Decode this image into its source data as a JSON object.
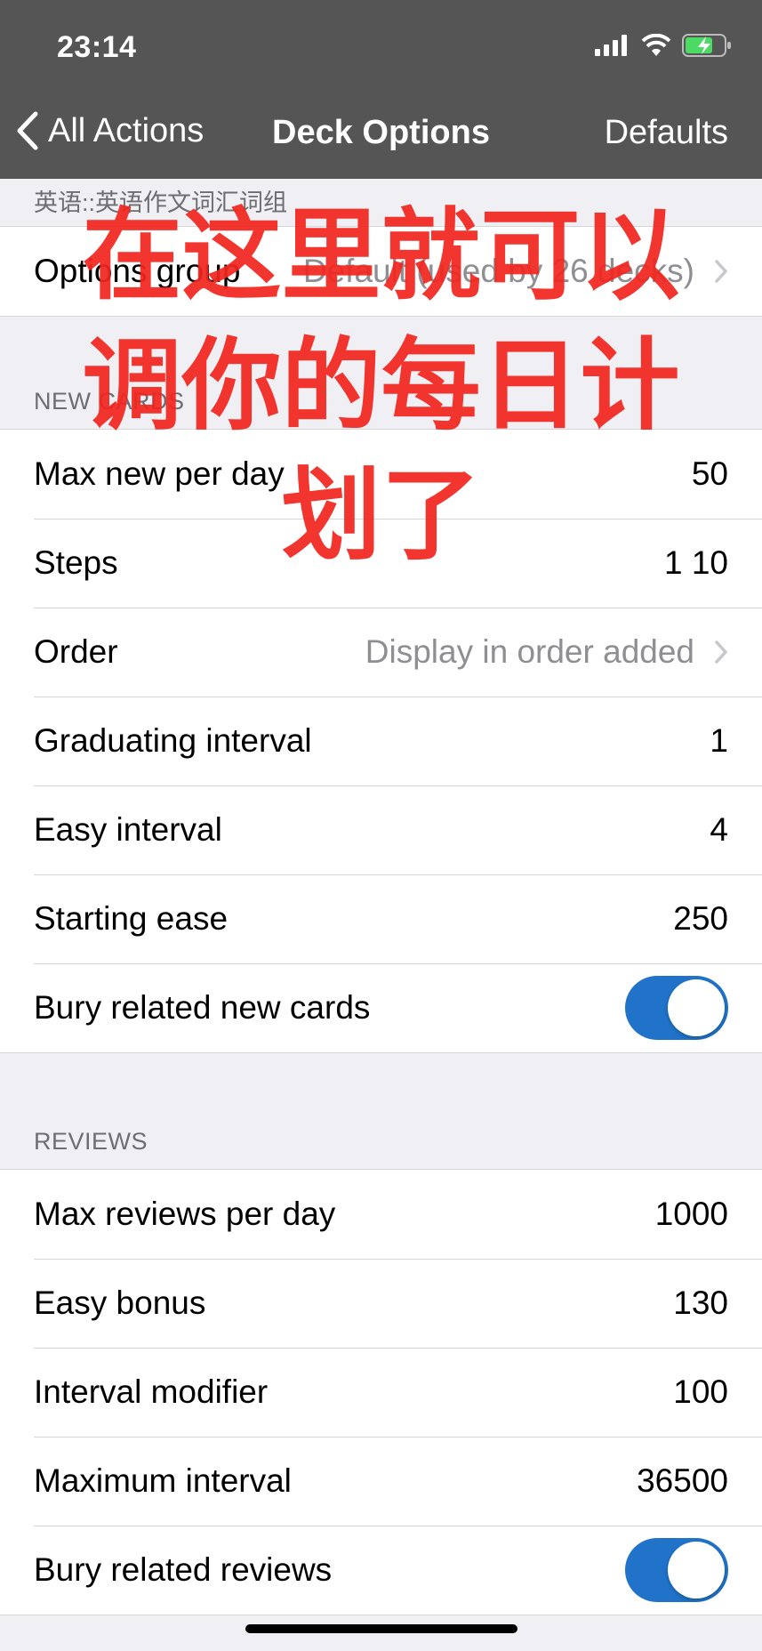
{
  "status_bar": {
    "time": "23:14"
  },
  "nav": {
    "back_label": "All Actions",
    "title": "Deck Options",
    "defaults_label": "Defaults"
  },
  "deck_path": "英语::英语作文词汇词组",
  "options_group": {
    "label": "Options group",
    "value": "Default (used by 26 decks)"
  },
  "new_cards": {
    "header": "NEW CARDS",
    "rows": [
      {
        "label": "Max new per day",
        "value": "50"
      },
      {
        "label": "Steps",
        "value": "1 10"
      },
      {
        "label": "Order",
        "value": "Display in order added"
      },
      {
        "label": "Graduating interval",
        "value": "1"
      },
      {
        "label": "Easy interval",
        "value": "4"
      },
      {
        "label": "Starting ease",
        "value": "250"
      },
      {
        "label": "Bury related new cards",
        "toggle_on": true
      }
    ]
  },
  "reviews": {
    "header": "REVIEWS",
    "rows": [
      {
        "label": "Max reviews per day",
        "value": "1000"
      },
      {
        "label": "Easy bonus",
        "value": "130"
      },
      {
        "label": "Interval modifier",
        "value": "100"
      },
      {
        "label": "Maximum interval",
        "value": "36500"
      },
      {
        "label": "Bury related reviews",
        "toggle_on": true
      }
    ]
  },
  "overlay_text": [
    "在这里就可以",
    "调你的每日计",
    "划了"
  ],
  "colors": {
    "nav_bg": "#555555",
    "toggle_on": "#2073c9",
    "overlay_red": "#f2261f",
    "battery_green": "#4cd964"
  }
}
